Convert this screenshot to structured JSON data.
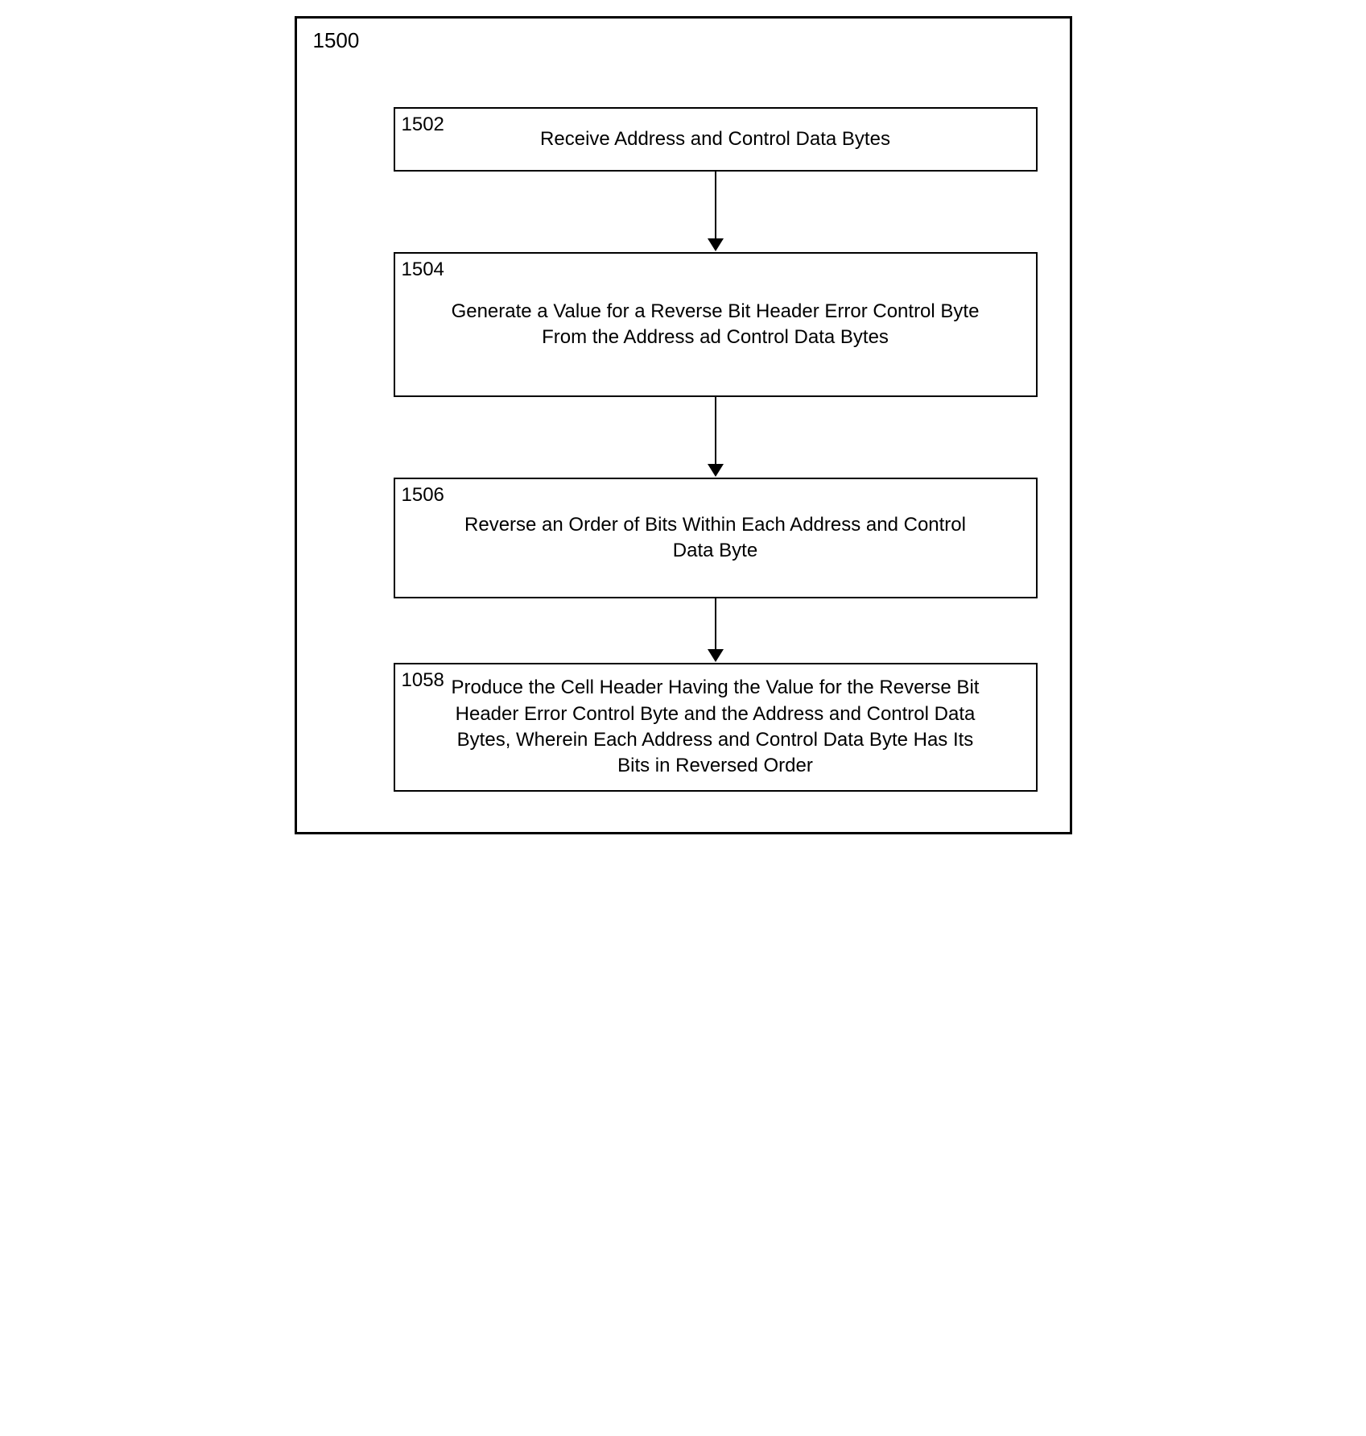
{
  "diagram": {
    "label": "1500",
    "boxes": {
      "b1": {
        "label": "1502",
        "text": "Receive Address and Control Data Bytes"
      },
      "b2": {
        "label": "1504",
        "text": "Generate a Value for a Reverse Bit Header Error Control Byte From the Address ad Control Data Bytes"
      },
      "b3": {
        "label": "1506",
        "text": "Reverse an Order of Bits Within Each Address and Control Data Byte"
      },
      "b4": {
        "label": "1058",
        "text": "Produce the Cell Header Having the Value for the Reverse Bit Header Error Control Byte and the Address and Control Data Bytes, Wherein Each Address and Control Data Byte Has Its Bits in Reversed Order"
      }
    }
  }
}
